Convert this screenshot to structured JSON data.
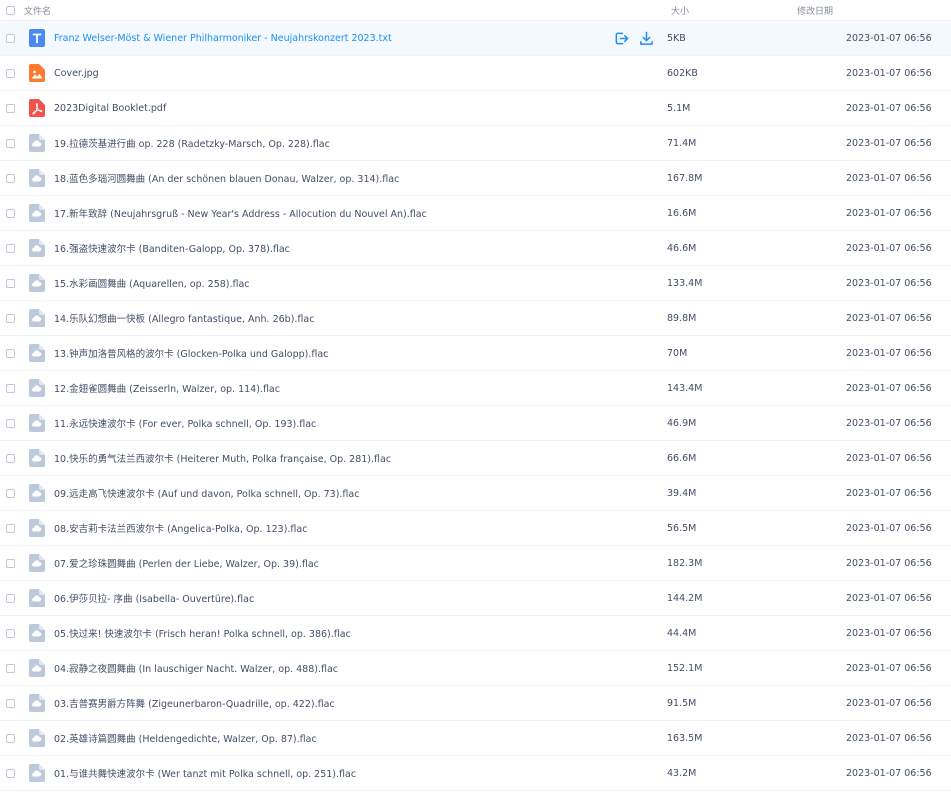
{
  "header": {
    "name_label": "文件名",
    "size_label": "大小",
    "date_label": "修改日期"
  },
  "colors": {
    "txt_icon": "#4a8af4",
    "image_icon": "#ff7a2f",
    "pdf_icon": "#f0544f",
    "audio_icon": "#bcc9da",
    "link_blue": "#1b8ff0",
    "hover_row": "#f4f9ff"
  },
  "files": [
    {
      "name": "Franz Welser-Möst & Wiener Philharmoniker - Neujahrskonzert 2023.txt",
      "size": "5KB",
      "date": "2023-01-07 06:56",
      "type": "txt",
      "hovered": true
    },
    {
      "name": "Cover.jpg",
      "size": "602KB",
      "date": "2023-01-07 06:56",
      "type": "image"
    },
    {
      "name": "2023Digital Booklet.pdf",
      "size": "5.1M",
      "date": "2023-01-07 06:56",
      "type": "pdf"
    },
    {
      "name": "19.拉德茨基进行曲 op. 228 (Radetzky-Marsch, Op. 228).flac",
      "size": "71.4M",
      "date": "2023-01-07 06:56",
      "type": "audio"
    },
    {
      "name": "18.蓝色多瑙河圆舞曲 (An der schönen blauen Donau, Walzer, op. 314).flac",
      "size": "167.8M",
      "date": "2023-01-07 06:56",
      "type": "audio"
    },
    {
      "name": "17.新年致辞 (Neujahrsgruß - New Year's Address - Allocution du Nouvel An).flac",
      "size": "16.6M",
      "date": "2023-01-07 06:56",
      "type": "audio"
    },
    {
      "name": "16.强盗快速波尔卡 (Banditen-Galopp, Op. 378).flac",
      "size": "46.6M",
      "date": "2023-01-07 06:56",
      "type": "audio"
    },
    {
      "name": "15.水彩画圆舞曲 (Aquarellen, op. 258).flac",
      "size": "133.4M",
      "date": "2023-01-07 06:56",
      "type": "audio"
    },
    {
      "name": "14.乐队幻想曲一快板 (Allegro fantastique, Anh. 26b).flac",
      "size": "89.8M",
      "date": "2023-01-07 06:56",
      "type": "audio"
    },
    {
      "name": "13.钟声加洛普风格的波尔卡 (Glocken-Polka und Galopp).flac",
      "size": "70M",
      "date": "2023-01-07 06:56",
      "type": "audio"
    },
    {
      "name": "12.金翅雀圆舞曲 (Zeisserln, Walzer, op. 114).flac",
      "size": "143.4M",
      "date": "2023-01-07 06:56",
      "type": "audio"
    },
    {
      "name": "11.永远快速波尔卡 (For ever, Polka schnell, Op. 193).flac",
      "size": "46.9M",
      "date": "2023-01-07 06:56",
      "type": "audio"
    },
    {
      "name": "10.快乐的勇气法兰西波尔卡 (Heiterer Muth, Polka française, Op. 281).flac",
      "size": "66.6M",
      "date": "2023-01-07 06:56",
      "type": "audio"
    },
    {
      "name": "09.远走高飞快速波尔卡 (Auf und davon, Polka schnell, Op. 73).flac",
      "size": "39.4M",
      "date": "2023-01-07 06:56",
      "type": "audio"
    },
    {
      "name": "08.安吉莉卡法兰西波尔卡 (Angelica-Polka, Op. 123).flac",
      "size": "56.5M",
      "date": "2023-01-07 06:56",
      "type": "audio"
    },
    {
      "name": "07.爱之珍珠圆舞曲 (Perlen der Liebe, Walzer, Op. 39).flac",
      "size": "182.3M",
      "date": "2023-01-07 06:56",
      "type": "audio"
    },
    {
      "name": "06.伊莎贝拉- 序曲 (Isabella- Ouvertüre).flac",
      "size": "144.2M",
      "date": "2023-01-07 06:56",
      "type": "audio"
    },
    {
      "name": "05.快过来! 快速波尔卡 (Frisch heran! Polka schnell, op. 386).flac",
      "size": "44.4M",
      "date": "2023-01-07 06:56",
      "type": "audio"
    },
    {
      "name": "04.寂静之夜圆舞曲 (In lauschiger Nacht. Walzer, op. 488).flac",
      "size": "152.1M",
      "date": "2023-01-07 06:56",
      "type": "audio"
    },
    {
      "name": "03.吉普赛男爵方阵舞 (Zigeunerbaron-Quadrille, op. 422).flac",
      "size": "91.5M",
      "date": "2023-01-07 06:56",
      "type": "audio"
    },
    {
      "name": "02.英雄诗篇圆舞曲 (Heldengedichte, Walzer, Op. 87).flac",
      "size": "163.5M",
      "date": "2023-01-07 06:56",
      "type": "audio"
    },
    {
      "name": "01.与谁共舞快速波尔卡 (Wer tanzt mit Polka schnell, op. 251).flac",
      "size": "43.2M",
      "date": "2023-01-07 06:56",
      "type": "audio"
    }
  ],
  "row_actions": {
    "share_icon": "share-icon",
    "download_icon": "download-icon"
  }
}
